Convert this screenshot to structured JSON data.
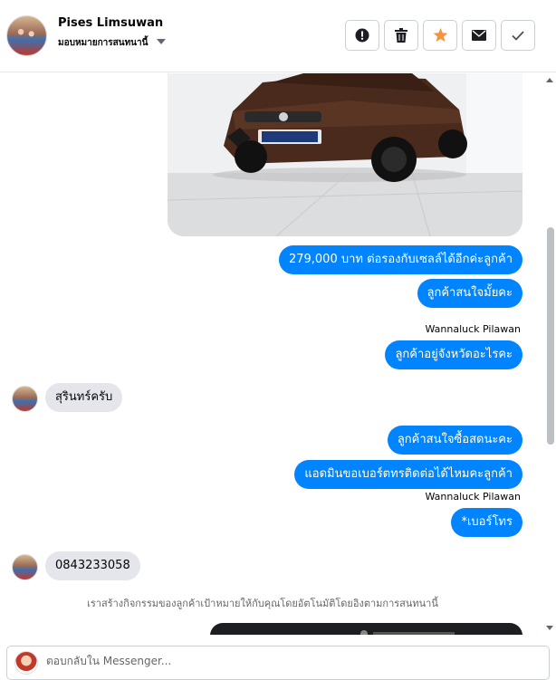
{
  "header": {
    "name": "Pises Limsuwan",
    "subtitle": "มอบหมายการสนทนานี้",
    "actions": [
      {
        "icon": "alert-icon",
        "label": "Mark as spam"
      },
      {
        "icon": "trash-icon",
        "label": "Delete"
      },
      {
        "icon": "star-icon",
        "label": "Star"
      },
      {
        "icon": "mail-icon",
        "label": "Mark as unread"
      },
      {
        "icon": "check-icon",
        "label": "Mark as done"
      }
    ]
  },
  "messages": {
    "m1": "279,000 บาท  ต่อรองกับเซลล์ได้อีกค่ะลูกค้า",
    "m2": "ลูกค้าสนใจมั้ยคะ",
    "sender1": "Wannaluck Pilawan",
    "m3": "ลูกค้าอยู่จังหวัดอะไรคะ",
    "m4": "สุรินทร์ครับ",
    "m5": "ลูกค้าสนใจซื้อสดนะคะ",
    "m6": "แอดมินขอเบอร์ตทรติดต่อได้ไหมคะลูกค้า",
    "sender2": "Wannaluck Pilawan",
    "m7": "*เบอร์โทร",
    "m8": "0843233058",
    "notice": "เราสร้างกิจกรรมของลูกค้าเป้าหมายให้กับคุณโดยอัตโนมัติโดยอิงตามการสนทนานี้"
  },
  "composer": {
    "placeholder": "ตอบกลับใน Messenger..."
  },
  "colors": {
    "outgoing_bubble": "#0084ff",
    "incoming_bubble": "#e4e6eb",
    "star": "#f7923b"
  }
}
